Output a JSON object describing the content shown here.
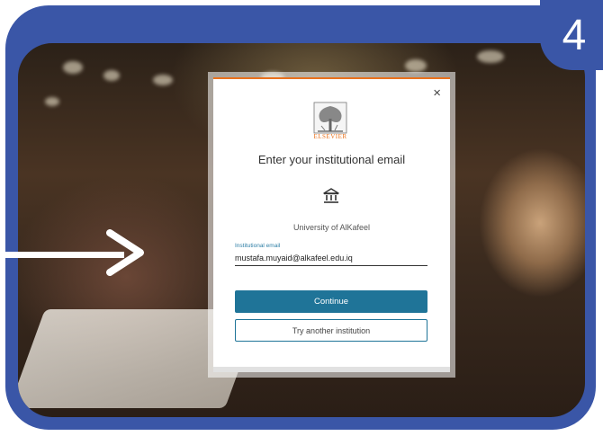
{
  "step": {
    "number": "4"
  },
  "dialog": {
    "close_label": "×",
    "brand": {
      "name": "ELSEVIER",
      "color": "#e9711c"
    },
    "heading": "Enter your institutional email",
    "institution_icon": "institution-building-icon",
    "institution_name": "University of AlKafeel",
    "email_field": {
      "label": "Institutional email",
      "value": "mustafa.muyaid@alkafeel.edu.iq"
    },
    "continue_label": "Continue",
    "another_label": "Try another institution"
  },
  "colors": {
    "frame": "#3a56a7",
    "primary_button": "#1f7498",
    "accent": "#e9711c"
  },
  "pointer": {
    "icon": "arrow-right-icon"
  }
}
